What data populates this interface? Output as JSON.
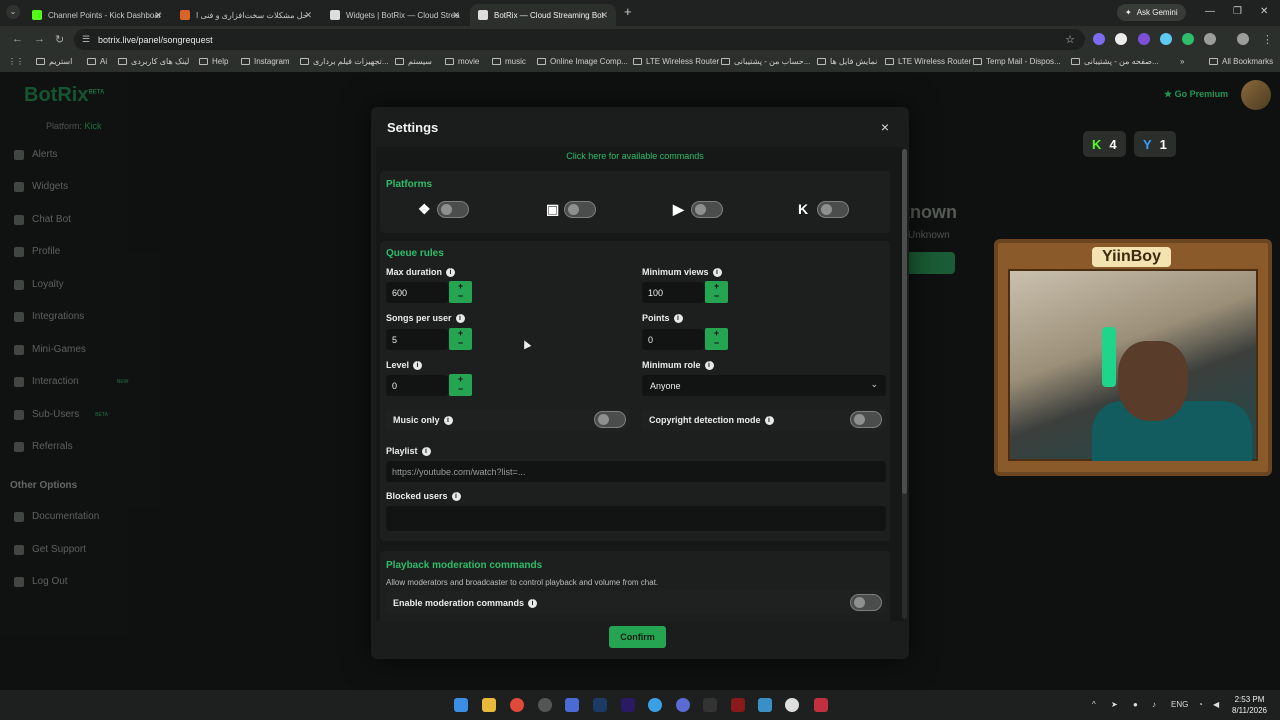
{
  "browser": {
    "tabs": [
      {
        "title": "Channel Points - Kick Dashboar",
        "color": "#53fc18"
      },
      {
        "title": "حل مشکلات سخت‌افزاری و فنی ا",
        "color": "#d9642a"
      },
      {
        "title": "Widgets | BotRix — Cloud Strea",
        "color": "#dddddd"
      },
      {
        "title": "BotRix — Cloud Streaming Bot",
        "color": "#dddddd"
      }
    ],
    "new_tab": "+",
    "ask_gemini": "Ask Gemini",
    "url": "botrix.live/panel/songrequest",
    "bookmarks": [
      "استریم",
      "Ai",
      "لینک های کاربردی",
      "Help",
      "Instagram",
      "تجهیزات فیلم برداری...",
      "سیستم",
      "movie",
      "music",
      "Online Image Comp...",
      "LTE Wireless Router",
      "حساب من - پشتیبانی...",
      "نمایش فایل ها",
      "LTE Wireless Router",
      "Temp Mail - Dispos...",
      "صفحه من - پشتیبانی..."
    ],
    "all_bookmarks": "All Bookmarks"
  },
  "app": {
    "logo": "BotRix",
    "logo_badge": "BETA",
    "platform_label": "Platform:",
    "platform_value": "Kick",
    "sidebar": [
      {
        "label": "Alerts"
      },
      {
        "label": "Widgets"
      },
      {
        "label": "Chat Bot"
      },
      {
        "label": "Profile"
      },
      {
        "label": "Loyalty"
      },
      {
        "label": "Integrations"
      },
      {
        "label": "Mini-Games"
      },
      {
        "label": "Interaction",
        "badge": "NEW"
      },
      {
        "label": "Sub-Users",
        "badge": "BETA"
      },
      {
        "label": "Referrals"
      }
    ],
    "other_options_title": "Other Options",
    "other_options": [
      {
        "label": "Documentation"
      },
      {
        "label": "Get Support"
      },
      {
        "label": "Log Out"
      }
    ],
    "go_premium": "Go Premium",
    "backdrop_title": "known",
    "backdrop_sub": "Unknown",
    "counts": {
      "kick": "4",
      "other": "1"
    },
    "cam_name": "YiinBoy"
  },
  "modal": {
    "title": "Settings",
    "close": "×",
    "commands_link": "Click here for available commands",
    "platforms_title": "Platforms",
    "queue_rules_title": "Queue rules",
    "fields": {
      "max_duration": {
        "label": "Max duration",
        "value": "600"
      },
      "minimum_views": {
        "label": "Minimum views",
        "value": "100"
      },
      "songs_per_user": {
        "label": "Songs per user",
        "value": "5"
      },
      "points": {
        "label": "Points",
        "value": "0"
      },
      "level": {
        "label": "Level",
        "value": "0"
      },
      "minimum_role": {
        "label": "Minimum role",
        "value": "Anyone"
      }
    },
    "music_only": "Music only",
    "copyright_mode": "Copyright detection mode",
    "playlist_label": "Playlist",
    "playlist_placeholder": "https://youtube.com/watch?list=...",
    "blocked_users_label": "Blocked users",
    "playback_title": "Playback moderation commands",
    "playback_desc": "Allow moderators and broadcaster to control playback and volume from chat.",
    "enable_moderation": "Enable moderation commands",
    "confirm": "Confirm"
  },
  "taskbar": {
    "lang": "ENG",
    "time": "2:53 PM",
    "date": "8/11/2026"
  }
}
